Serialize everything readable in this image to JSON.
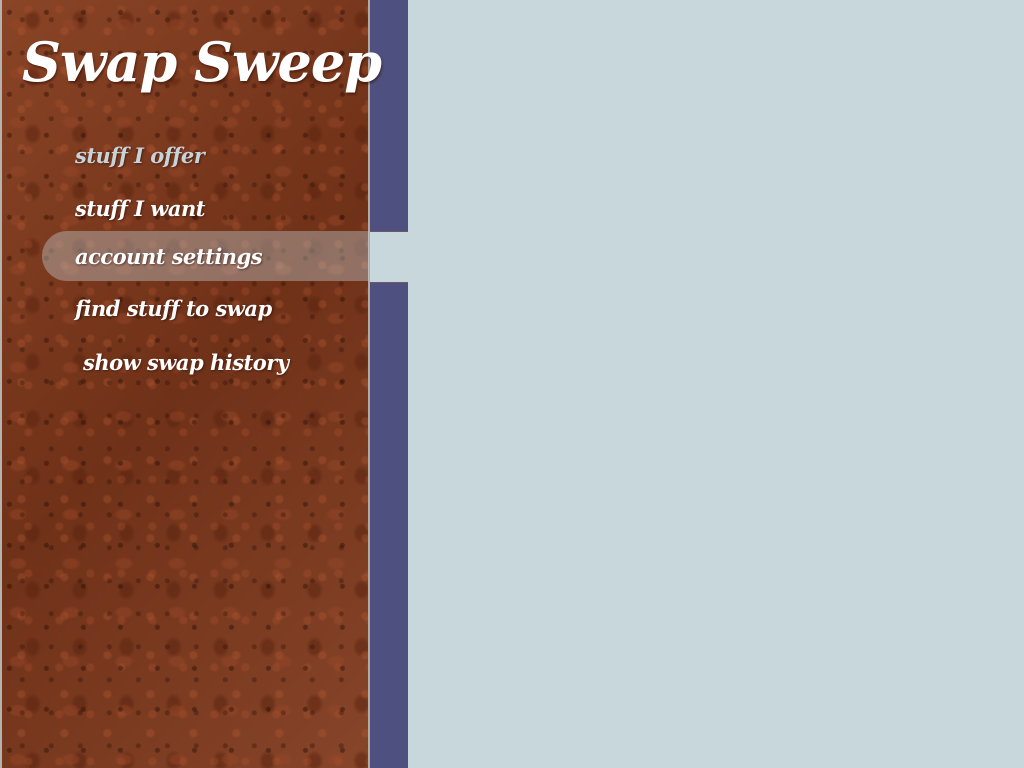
{
  "app": {
    "title": "Swap Sweep"
  },
  "nav": {
    "items": [
      {
        "label": "stuff I offer",
        "state": "hover"
      },
      {
        "label": "stuff I want",
        "state": "normal"
      },
      {
        "label": "account settings",
        "state": "active"
      },
      {
        "label": "find stuff to swap",
        "state": "normal"
      },
      {
        "label": "show swap history",
        "state": "normal"
      }
    ]
  },
  "colors": {
    "sidebar_brown": "#7a3a20",
    "accent_bar": "#4e517f",
    "main_background": "#c8d7dc",
    "nav_text": "#ffffff",
    "nav_text_dim": "#c6d3d8"
  }
}
